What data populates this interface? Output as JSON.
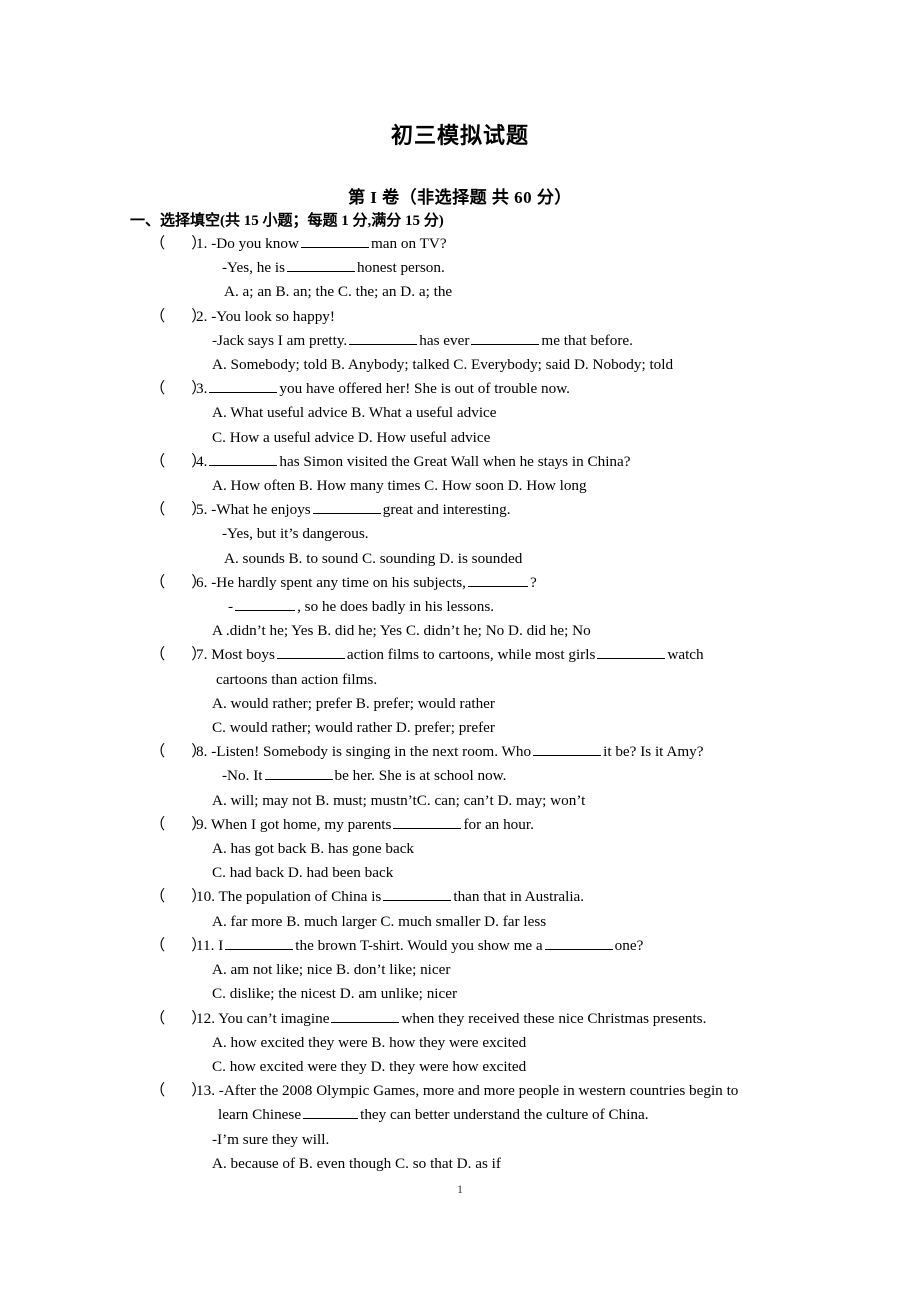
{
  "document": {
    "title": "初三模拟试题",
    "part_heading": "第 I 卷（非选择题   共 60 分）",
    "section_heading": "一、选择填空(共 15 小题；每题 1 分,满分 15 分)",
    "page_number": "1"
  },
  "marker": {
    "open": "（",
    "close": "）"
  },
  "questions": [
    {
      "number": "1.",
      "stem": "-Do you know",
      "stem_tail": "man on TV?",
      "reply": "-Yes, he is",
      "reply_tail": "honest person.",
      "options_line1": "A. a; an    B. an; the    C. the; an    D. a; the"
    },
    {
      "number": "2.",
      "stem": "-You look so happy!",
      "reply": "-Jack says I am pretty.",
      "reply_mid": "has ever",
      "reply_tail": "me that before.",
      "options_line1": "A. Somebody; told     B. Anybody; talked       C. Everybody; said     D. Nobody; told"
    },
    {
      "number": "3.",
      "stem_tail": "you have offered her! She is out of trouble now.",
      "options_line1": "A. What useful advice      B. What a useful advice",
      "options_line2": "C. How a useful advice      D. How useful advice"
    },
    {
      "number": "4.",
      "stem_tail": "has Simon visited the Great Wall when he stays in China?",
      "options_line1": "A. How often    B. How many times    C. How soon        D. How long"
    },
    {
      "number": "5.",
      "stem": "-What he enjoys",
      "stem_tail": "great and interesting.",
      "reply": "-Yes, but it’s dangerous.",
      "options_line1": "A. sounds      B. to sound     C. sounding      D. is sounded"
    },
    {
      "number": "6.",
      "stem": "-He hardly spent any time on his subjects,",
      "stem_tail": "?",
      "reply": "-",
      "reply_tail": ", so he does badly in his lessons.",
      "options_line1": "A .didn’t he; Yes    B. did he; Yes     C. didn’t he; No      D. did he; No"
    },
    {
      "number": "7.",
      "stem": "Most boys",
      "stem_mid": "action films to cartoons, while most girls",
      "stem_tail": "watch",
      "continuation": "cartoons    than action films.",
      "options_line1": "A. would rather; prefer        B. prefer; would rather",
      "options_line2": "C. would rather; would rather    D. prefer; prefer"
    },
    {
      "number": "8.",
      "stem": "-Listen! Somebody is singing in the next room. Who",
      "stem_tail": "it be? Is it Amy?",
      "reply": "-No. It",
      "reply_tail": "be her. She is at school now.",
      "options_line1": "A. will; may not  B. must; mustn’tC. can; can’t   D. may; won’t"
    },
    {
      "number": "9.",
      "stem": "When I got home, my parents",
      "stem_tail": "for an hour.",
      "options_line1": "A. has got back             B. has gone back",
      "options_line2": "C. had back             D. had been back"
    },
    {
      "number": "10.",
      "stem": "The population of China is",
      "stem_tail": "than that in Australia.",
      "options_line1": "A. far more              B. much larger              C. much smaller             D. far less"
    },
    {
      "number": "11.",
      "stem": "I",
      "stem_mid": "the brown T-shirt. Would you show me a",
      "stem_tail": "one?",
      "options_line1": "A. am not like; nice      B. don’t like; nicer",
      "options_line2": "C. dislike; the nicest      D. am unlike; nicer"
    },
    {
      "number": "12.",
      "stem": "You can’t imagine",
      "stem_tail": "when they received these nice Christmas presents.",
      "options_line1": "A. how excited they were      B. how they were excited",
      "options_line2": "C. how excited were they       D. they were how excited"
    },
    {
      "number": "13.",
      "stem": "-After the 2008 Olympic Games, more and more people in western countries begin to",
      "continuation": "learn Chinese",
      "continuation_tail": "they can better understand the culture of China.",
      "reply": "-I’m sure they will.",
      "options_line1": "A. because of    B. even though    C. so that      D. as if"
    }
  ]
}
